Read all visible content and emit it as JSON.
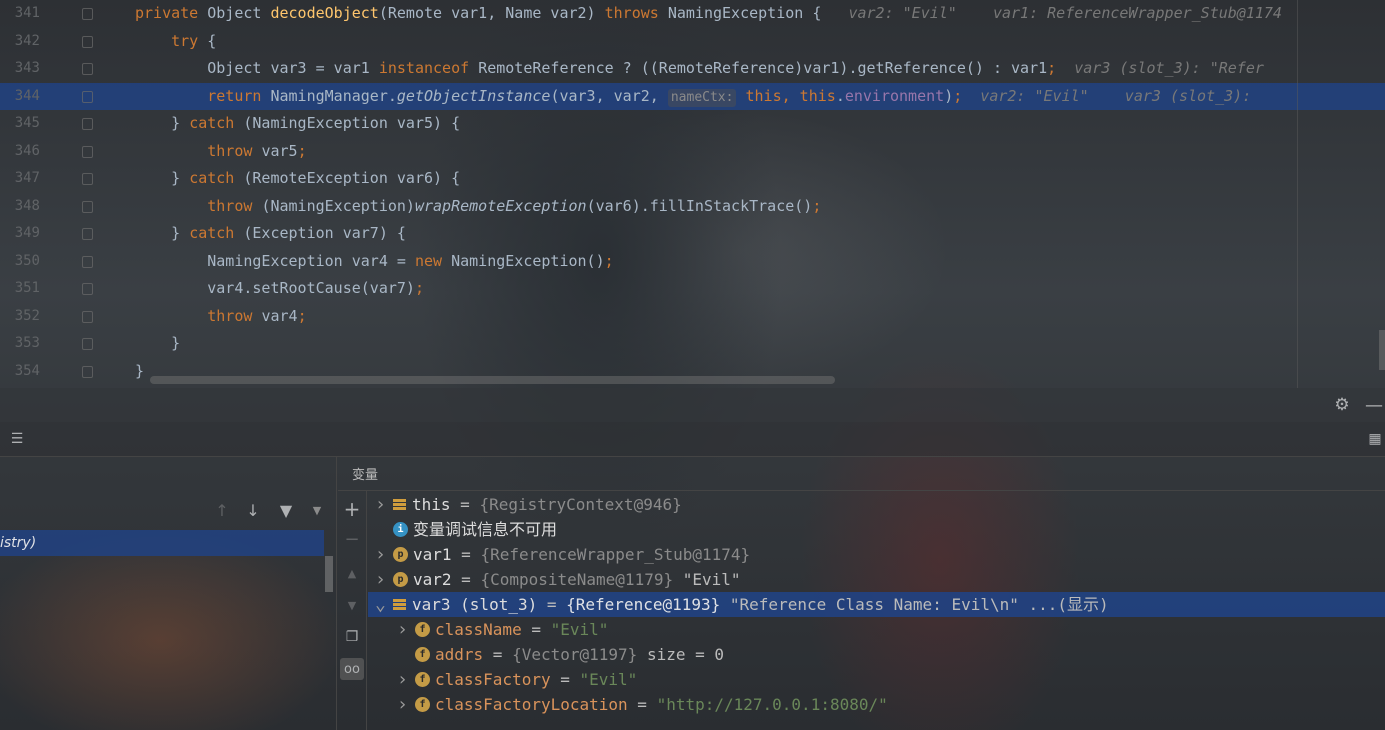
{
  "editor": {
    "lines": [
      {
        "num": "341",
        "tokens": [
          [
            "kw",
            "private "
          ],
          [
            "",
            "Object "
          ],
          [
            "fn",
            "decodeObject"
          ],
          [
            "",
            "(Remote var1, Name var2) "
          ],
          [
            "kw",
            "throws "
          ],
          [
            "",
            "NamingException {  "
          ],
          [
            "hint",
            " var2: \"Evil\"    var1: ReferenceWrapper_Stub@1174"
          ]
        ]
      },
      {
        "num": "342",
        "tokens": [
          [
            "",
            "    "
          ],
          [
            "kw",
            "try "
          ],
          [
            "",
            "{"
          ]
        ]
      },
      {
        "num": "343",
        "tokens": [
          [
            "",
            "        Object var3 = var1 "
          ],
          [
            "kw",
            "instanceof "
          ],
          [
            "",
            "RemoteReference ? ((RemoteReference)var1).getReference() : var1"
          ],
          [
            "kw",
            ";"
          ],
          [
            "hint",
            "  var3 (slot_3): \"Refer"
          ]
        ]
      },
      {
        "num": "344",
        "tokens": [
          [
            "",
            "        "
          ],
          [
            "kw",
            "return "
          ],
          [
            "",
            "NamingManager."
          ],
          [
            "it",
            "getObjectInstance"
          ],
          [
            "",
            "(var3, var2, "
          ],
          [
            "param",
            "nameCtx:"
          ],
          [
            "kw",
            " this, this"
          ],
          [
            "",
            "."
          ],
          [
            "fld",
            "environment"
          ],
          [
            "",
            ")"
          ],
          [
            "kw",
            ";"
          ],
          [
            "hint",
            "  var2: \"Evil\"    var3 (slot_3): "
          ]
        ]
      },
      {
        "num": "345",
        "tokens": [
          [
            "",
            "    } "
          ],
          [
            "kw",
            "catch "
          ],
          [
            "",
            "(NamingException var5) {"
          ]
        ]
      },
      {
        "num": "346",
        "tokens": [
          [
            "",
            "        "
          ],
          [
            "kw",
            "throw "
          ],
          [
            "",
            "var5"
          ],
          [
            "kw",
            ";"
          ]
        ]
      },
      {
        "num": "347",
        "tokens": [
          [
            "",
            "    } "
          ],
          [
            "kw",
            "catch "
          ],
          [
            "",
            "(RemoteException var6) {"
          ]
        ]
      },
      {
        "num": "348",
        "tokens": [
          [
            "",
            "        "
          ],
          [
            "kw",
            "throw "
          ],
          [
            "",
            "(NamingException)"
          ],
          [
            "it",
            "wrapRemoteException"
          ],
          [
            "",
            "(var6).fillInStackTrace()"
          ],
          [
            "kw",
            ";"
          ]
        ]
      },
      {
        "num": "349",
        "tokens": [
          [
            "",
            "    } "
          ],
          [
            "kw",
            "catch "
          ],
          [
            "",
            "(Exception var7) {"
          ]
        ]
      },
      {
        "num": "350",
        "tokens": [
          [
            "",
            "        NamingException var4 = "
          ],
          [
            "kw",
            "new "
          ],
          [
            "",
            "NamingException()"
          ],
          [
            "kw",
            ";"
          ]
        ]
      },
      {
        "num": "351",
        "tokens": [
          [
            "",
            "        var4.setRootCause(var7)"
          ],
          [
            "kw",
            ";"
          ]
        ]
      },
      {
        "num": "352",
        "tokens": [
          [
            "",
            "        "
          ],
          [
            "kw",
            "throw "
          ],
          [
            "",
            "var4"
          ],
          [
            "kw",
            ";"
          ]
        ]
      },
      {
        "num": "353",
        "tokens": [
          [
            "",
            "    }"
          ]
        ]
      },
      {
        "num": "354",
        "tokens": [
          [
            "",
            "}"
          ]
        ]
      }
    ],
    "current_line": "344"
  },
  "debugger": {
    "frames_selected": "istry)",
    "variables_title": "变量",
    "variables": [
      {
        "indent": 0,
        "expand": ">",
        "icon": "obj",
        "name": "this",
        "name_style": "plain",
        "eq": " = ",
        "type": "{RegistryContext@946}",
        "value": ""
      },
      {
        "indent": 0,
        "expand": "",
        "icon": "info",
        "name": "变量调试信息不可用",
        "name_style": "plain",
        "eq": "",
        "type": "",
        "value": ""
      },
      {
        "indent": 0,
        "expand": ">",
        "icon": "p",
        "name": "var1",
        "name_style": "plain",
        "eq": " = ",
        "type": "{ReferenceWrapper_Stub@1174}",
        "value": ""
      },
      {
        "indent": 0,
        "expand": ">",
        "icon": "p",
        "name": "var2",
        "name_style": "plain",
        "eq": " = ",
        "type": "{CompositeName@1179}",
        "value": " \"Evil\""
      },
      {
        "indent": 0,
        "expand": "v",
        "icon": "obj",
        "name": "var3 (slot_3)",
        "name_style": "plain",
        "eq": " = ",
        "type": "{Reference@1193}",
        "value": " \"Reference Class Name: Evil\\n\" ...(显示)",
        "selected": true
      },
      {
        "indent": 1,
        "expand": ">",
        "icon": "f",
        "name": "className",
        "name_style": "orange",
        "eq": " = ",
        "type": "",
        "value": "\"Evil\""
      },
      {
        "indent": 1,
        "expand": "",
        "icon": "f",
        "name": "addrs",
        "name_style": "orange",
        "eq": " = ",
        "type": "{Vector@1197}",
        "value": "  size = 0"
      },
      {
        "indent": 1,
        "expand": ">",
        "icon": "f",
        "name": "classFactory",
        "name_style": "orange",
        "eq": " = ",
        "type": "",
        "value": "\"Evil\""
      },
      {
        "indent": 1,
        "expand": ">",
        "icon": "f",
        "name": "classFactoryLocation",
        "name_style": "orange",
        "eq": " = ",
        "type": "",
        "value": "\"http://127.0.0.1:8080/\""
      }
    ]
  },
  "icons": {
    "settings": "gear-icon",
    "minimize": "minimize-icon",
    "add": "plus-icon",
    "up": "arrow-up-icon",
    "down": "arrow-down-icon",
    "filter": "filter-icon",
    "copy": "copy-icon",
    "watch": "glasses-icon"
  }
}
